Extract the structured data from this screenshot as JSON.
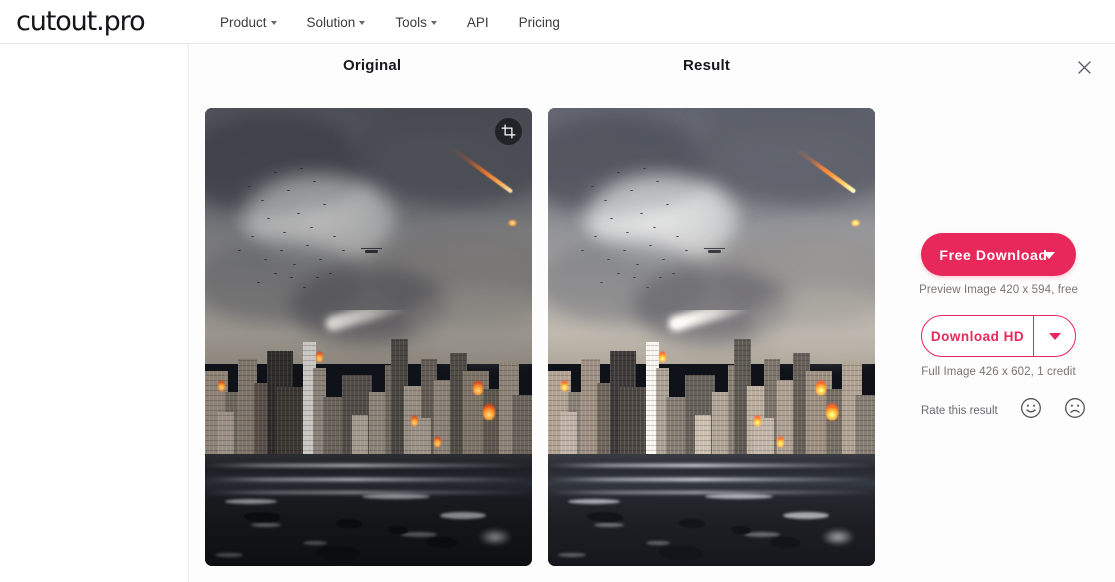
{
  "nav": {
    "brand": "cutout.pro",
    "links": [
      {
        "label": "Product",
        "caret": true,
        "name": "nav-product"
      },
      {
        "label": "Solution",
        "caret": true,
        "name": "nav-solution"
      },
      {
        "label": "Tools",
        "caret": true,
        "name": "nav-tools"
      },
      {
        "label": "API",
        "caret": false,
        "name": "nav-api"
      },
      {
        "label": "Pricing",
        "caret": false,
        "name": "nav-pricing"
      }
    ]
  },
  "workspace": {
    "original_title": "Original",
    "result_title": "Result",
    "close_icon": "✕",
    "crop_icon": "crop-icon"
  },
  "actions": {
    "free_download_label": "Free Download",
    "free_download_caption": "Preview Image 420 x 594, free",
    "download_hd_label": "Download HD",
    "download_hd_caption": "Full Image 426 x 602, 1 credit",
    "rate_label": "Rate this result",
    "rate_happy_icon": "happy-face-icon",
    "rate_sad_icon": "sad-face-icon"
  },
  "colors": {
    "accent": "#e8275a",
    "text_primary": "#17171c",
    "text_muted": "#7c736f",
    "border": "#e8e8e8"
  },
  "image_meta": {
    "preview_width": "420",
    "preview_height": "594",
    "full_width": "426",
    "full_height": "602",
    "credits": "1"
  }
}
